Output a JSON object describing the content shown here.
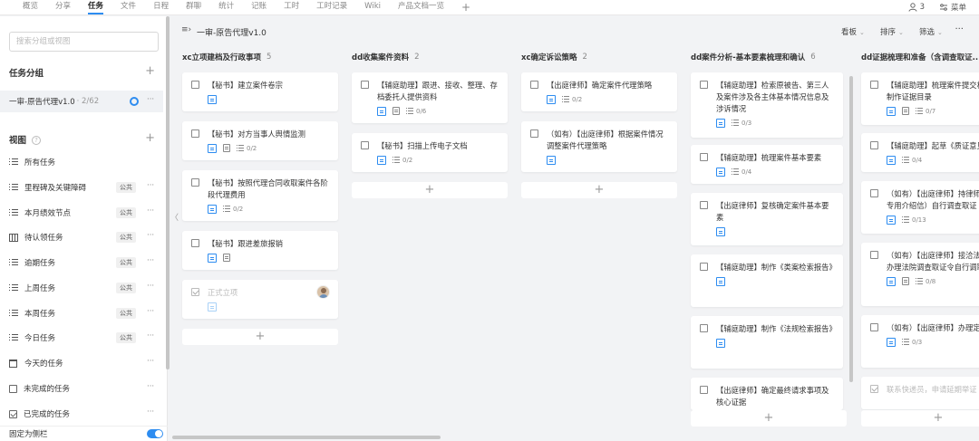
{
  "nav": {
    "tabs": [
      "概览",
      "分享",
      "任务",
      "文件",
      "日程",
      "群聊",
      "统计",
      "记账",
      "工时",
      "工时记录",
      "Wiki",
      "产品文档一览"
    ],
    "active": "任务",
    "plus": "+",
    "members_count": "3",
    "menu_label": "菜单"
  },
  "sidebar": {
    "search_placeholder": "搜索分组或视图",
    "group_title": "任务分组",
    "group_name": "一审-原告代理v1.0",
    "group_count": "· 2/62",
    "view_title": "视图",
    "help": "?",
    "views": [
      {
        "label": "所有任务",
        "badge": "",
        "icon": "list"
      },
      {
        "label": "里程碑及关键障碍",
        "badge": "公共",
        "icon": "list"
      },
      {
        "label": "本月绩效节点",
        "badge": "公共",
        "icon": "list"
      },
      {
        "label": "待认领任务",
        "badge": "公共",
        "icon": "board"
      },
      {
        "label": "逾期任务",
        "badge": "公共",
        "icon": "list"
      },
      {
        "label": "上周任务",
        "badge": "公共",
        "icon": "list"
      },
      {
        "label": "本周任务",
        "badge": "公共",
        "icon": "list"
      },
      {
        "label": "今日任务",
        "badge": "公共",
        "icon": "list"
      },
      {
        "label": "今天的任务",
        "badge": "",
        "icon": "calendar"
      },
      {
        "label": "未完成的任务",
        "badge": "",
        "icon": "checkbox"
      },
      {
        "label": "已完成的任务",
        "badge": "",
        "icon": "checked"
      }
    ],
    "more": "···",
    "pin_label": "固定为侧栏",
    "pin_on": true
  },
  "board": {
    "title": "一审-原告代理v1.0",
    "kanban_label": "看板",
    "sort_label": "排序",
    "filter_label": "筛选",
    "more": "···",
    "columns": [
      {
        "title": "xc立项建档及行政事项",
        "count": "5",
        "cards": [
          {
            "text": "【秘书】建立案件卷宗",
            "doc": false,
            "sub": ""
          },
          {
            "text": "【秘书】对方当事人舆情监测",
            "doc": true,
            "sub": "0/2"
          },
          {
            "text": "【秘书】按照代理合同收取案件各阶段代理费用",
            "doc": false,
            "sub": "0/2"
          },
          {
            "text": "【秘书】跟进差旅报销",
            "doc": true,
            "sub": ""
          },
          {
            "text": "正式立项",
            "doc": false,
            "sub": "",
            "done": true,
            "avatar": true
          }
        ]
      },
      {
        "title": "dd收集案件资料",
        "count": "2",
        "cards": [
          {
            "text": "【辅庭助理】跟进、接收、整理、存档委托人提供资料",
            "doc": true,
            "sub": "0/6"
          },
          {
            "text": "【秘书】扫描上传电子文档",
            "doc": false,
            "sub": "0/2"
          }
        ]
      },
      {
        "title": "xc确定诉讼策略",
        "count": "2",
        "cards": [
          {
            "text": "【出庭律师】确定案件代理策略",
            "doc": false,
            "sub": "0/2"
          },
          {
            "text": "（如有）【出庭律师】根据案件情况调整案件代理策略",
            "doc": false,
            "sub": ""
          }
        ]
      },
      {
        "title": "dd案件分析-基本要素梳理和确认",
        "count": "6",
        "cards": [
          {
            "text": "【辅庭助理】检索原被告、第三人及案件涉及各主体基本情况信息及涉诉情况",
            "doc": false,
            "sub": "0/3"
          },
          {
            "text": "【辅庭助理】梳理案件基本要素",
            "doc": false,
            "sub": "0/4"
          },
          {
            "text": "【出庭律师】复核确定案件基本要素",
            "doc": false,
            "sub": ""
          },
          {
            "text": "【辅庭助理】制作《类案检索报告》",
            "doc": false,
            "sub": ""
          },
          {
            "text": "【辅庭助理】制作《法规检索报告》",
            "doc": false,
            "sub": ""
          },
          {
            "text": "【出庭律师】确定最终请求事项及核心证据",
            "doc": false,
            "sub": ""
          }
        ]
      },
      {
        "title": "dd证据梳理和准备（含调查取证...",
        "count": "",
        "cards": [
          {
            "text": "【辅庭助理】梳理案件提交材料及制作证据目录",
            "doc": true,
            "sub": "0/7"
          },
          {
            "text": "【辅庭助理】起草《质证意见》",
            "doc": false,
            "sub": "0/4"
          },
          {
            "text": "（如有）【出庭律师】持律师调查专用介绍信）自行调查取证",
            "doc": false,
            "sub": "0/13"
          },
          {
            "text": "（如有）【出庭律师】接洽法官）办理法院调查取证令自行调取",
            "doc": true,
            "sub": "0/8"
          },
          {
            "text": "（如有）【出庭律师】办理定事项",
            "doc": false,
            "sub": "0/3"
          },
          {
            "text": "联系快递员，申请延期举证",
            "doc": false,
            "sub": "",
            "faded": true
          }
        ]
      }
    ]
  }
}
